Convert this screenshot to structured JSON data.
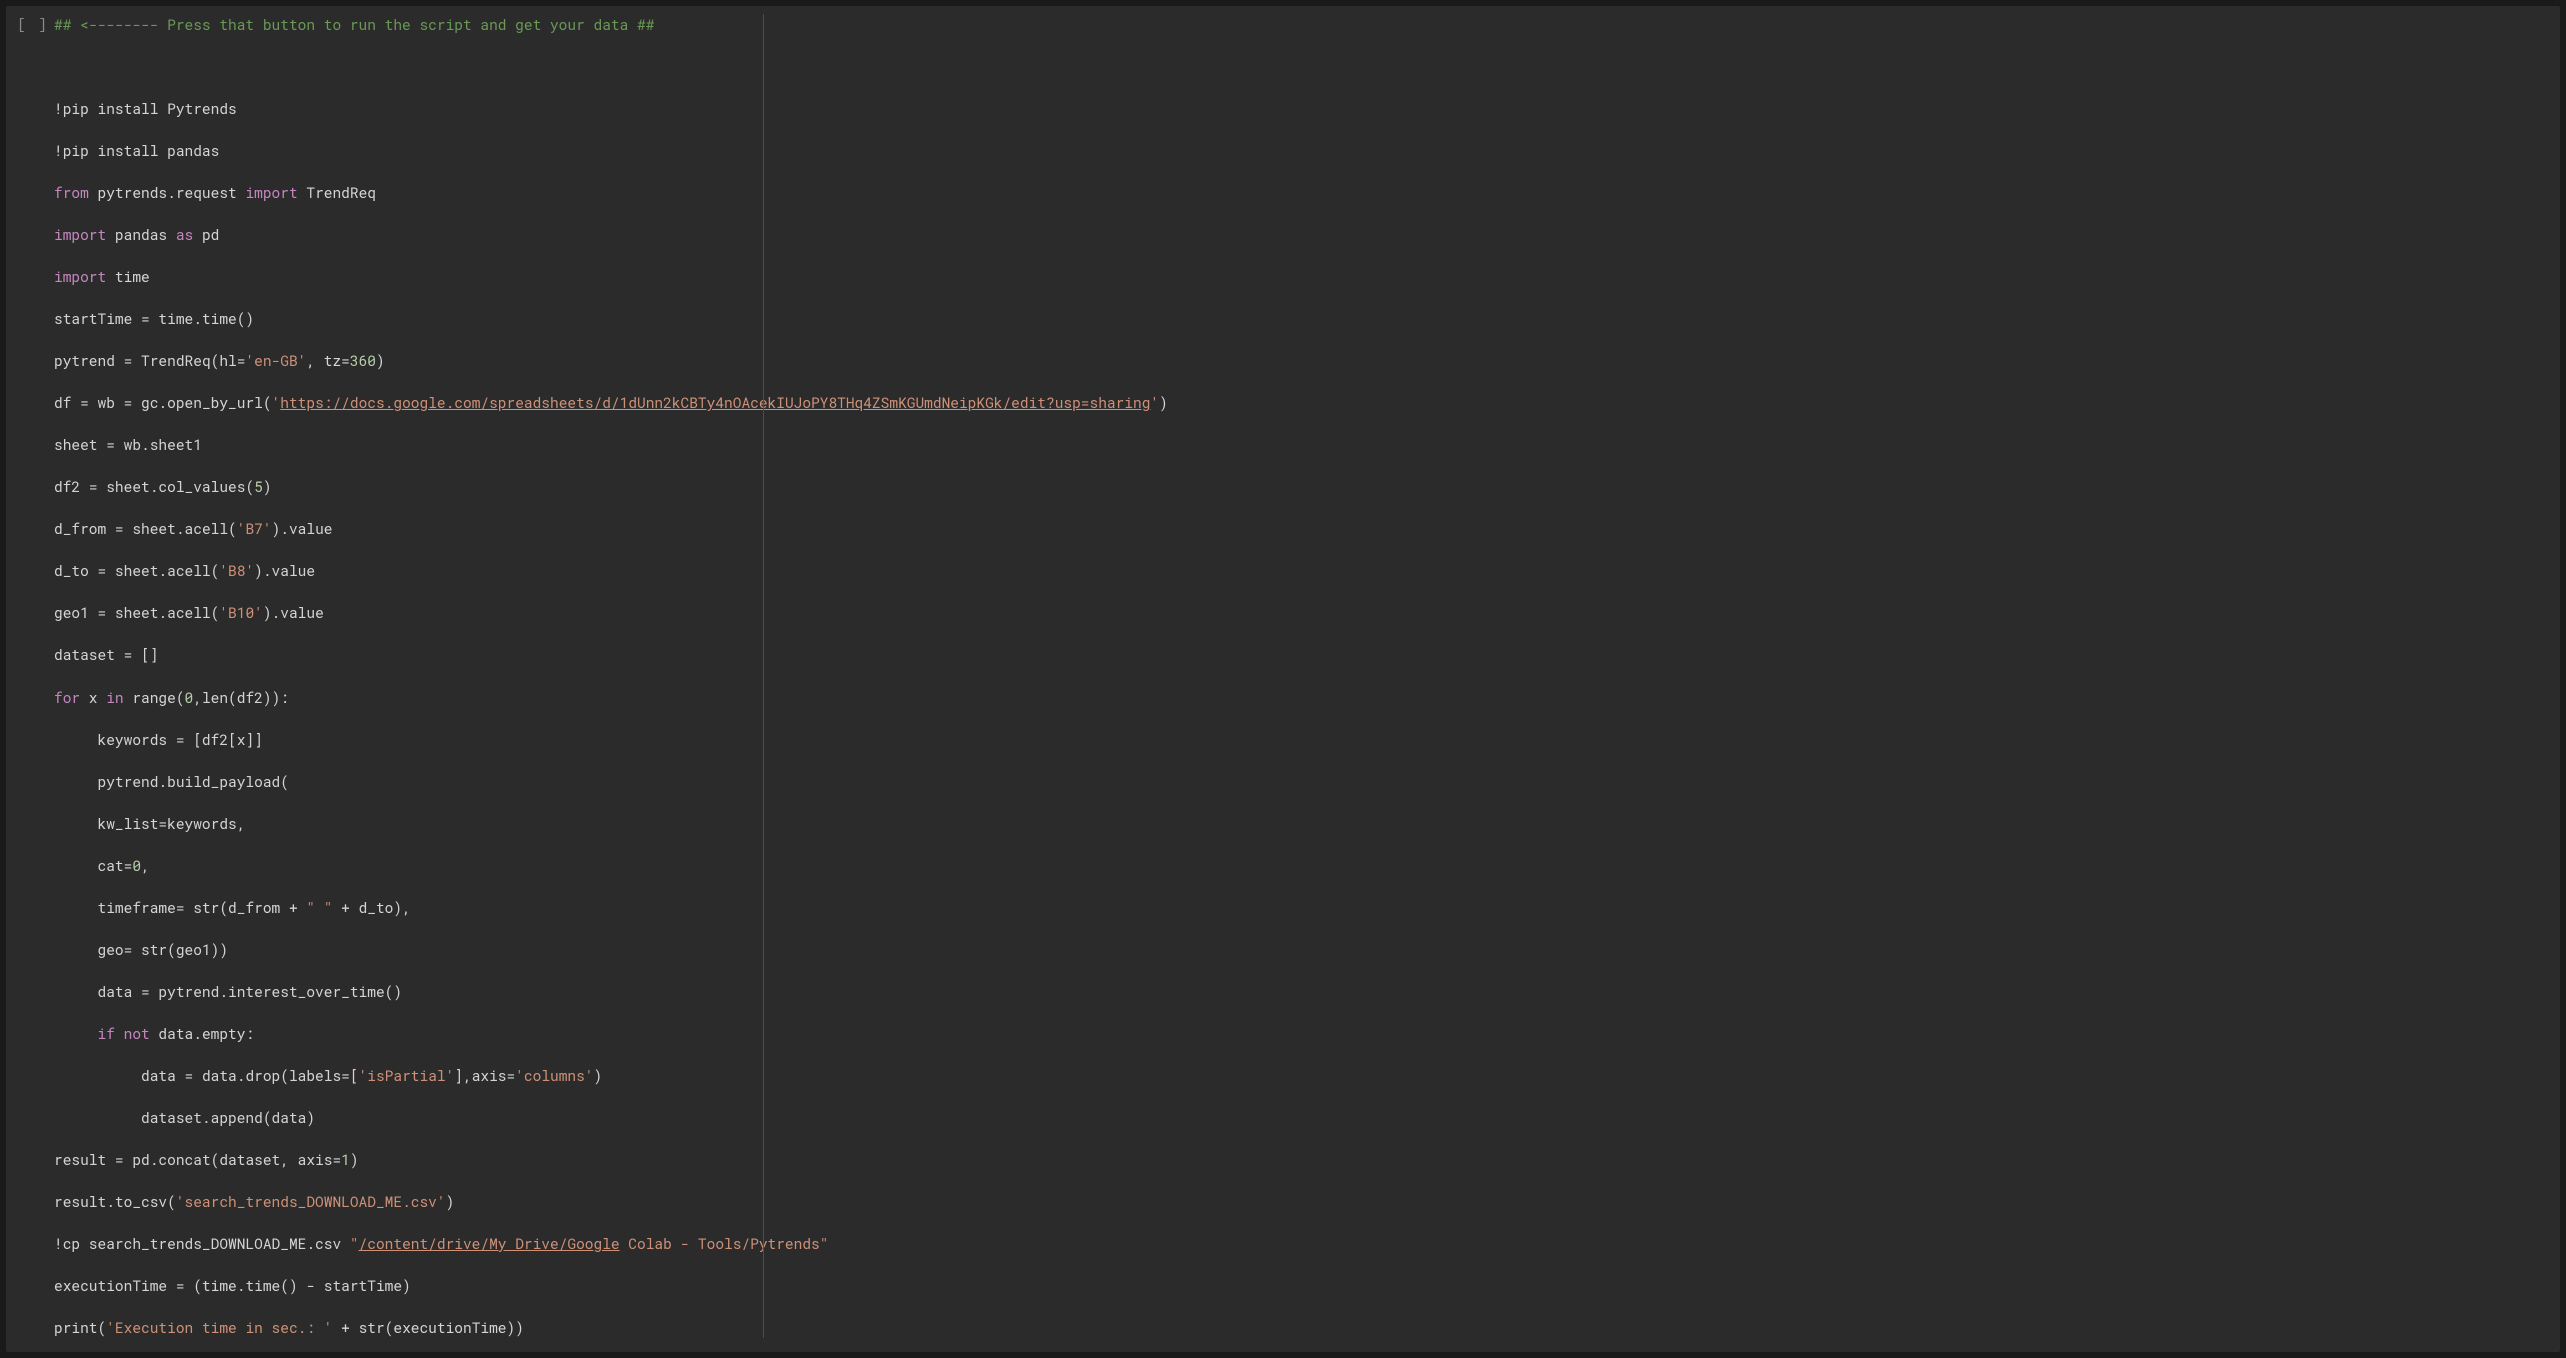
{
  "gutter": "[ ]",
  "code": {
    "comment_header": "## <-------- Press that button to run the script and get your data ##",
    "pip1_bang": "!",
    "pip1_rest": "pip install Pytrends",
    "pip2_bang": "!",
    "pip2_rest": "pip install pandas",
    "from": "from",
    "module1": " pytrends.request ",
    "import_kw1": "import",
    "import_name1": " TrendReq",
    "import_kw2": "import",
    "import_name2": " pandas ",
    "as_kw": "as",
    "as_name": " pd",
    "import_kw3": "import",
    "import_name3": " time",
    "l_starttime_a": "startTime ",
    "l_starttime_eq": "= ",
    "l_starttime_b": "time.time()",
    "l_pytrend_a": "pytrend ",
    "l_pytrend_eq": "= ",
    "l_pytrend_b": "TrendReq(hl=",
    "l_pytrend_str": "'en-GB'",
    "l_pytrend_c": ", tz=",
    "l_pytrend_num": "360",
    "l_pytrend_d": ")",
    "l_df_a": "df ",
    "l_df_eq1": "= ",
    "l_df_b": "wb ",
    "l_df_eq2": "= ",
    "l_df_c": "gc.open_by_url(",
    "l_df_q1": "'",
    "l_df_url": "https://docs.google.com/spreadsheets/d/1dUnn2kCBTy4nOAcekIUJoPY8THq4ZSmKGUmdNeipKGk/edit?usp=sharing",
    "l_df_q2": "'",
    "l_df_d": ")",
    "l_sheet_a": "sheet ",
    "l_sheet_eq": "= ",
    "l_sheet_b": "wb.sheet1",
    "l_df2_a": "df2 ",
    "l_df2_eq": "= ",
    "l_df2_b": "sheet.col_values(",
    "l_df2_num": "5",
    "l_df2_c": ")",
    "l_dfrom_a": "d_from ",
    "l_dfrom_eq": "= ",
    "l_dfrom_b": "sheet.acell(",
    "l_dfrom_str": "'B7'",
    "l_dfrom_c": ").value",
    "l_dto_a": "d_to ",
    "l_dto_eq": "= ",
    "l_dto_b": "sheet.acell(",
    "l_dto_str": "'B8'",
    "l_dto_c": ").value",
    "l_geo_a": "geo1 ",
    "l_geo_eq": "= ",
    "l_geo_b": "sheet.acell(",
    "l_geo_str": "'B10'",
    "l_geo_c": ").value",
    "l_dataset_a": "dataset ",
    "l_dataset_eq": "= ",
    "l_dataset_b": "[]",
    "for_kw": "for",
    "for_a": " x ",
    "in_kw": "in",
    "for_b": " range(",
    "for_num": "0",
    "for_c": ",len(df2)):",
    "l_kw_a": "     keywords ",
    "l_kw_eq": "= ",
    "l_kw_b": "[df2[x]]",
    "l_build": "     pytrend.build_payload(",
    "l_kwlist_a": "     kw_list",
    "l_kwlist_eq": "=",
    "l_kwlist_b": "keywords,",
    "l_cat_a": "     cat",
    "l_cat_eq": "=",
    "l_cat_num": "0",
    "l_cat_c": ",",
    "l_tf_a": "     timeframe",
    "l_tf_eq": "= ",
    "l_tf_b": "str(d_from + ",
    "l_tf_str": "\" \"",
    "l_tf_c": " + d_to),",
    "l_geoarg_a": "     geo",
    "l_geoarg_eq": "= ",
    "l_geoarg_b": "str(geo1))",
    "l_data_a": "     data ",
    "l_data_eq": "= ",
    "l_data_b": "pytrend.interest_over_time()",
    "if_kw": "if",
    "not_kw": "not",
    "if_pre": "     ",
    "if_mid": " ",
    "if_b": " data.empty:",
    "l_drop_a": "          data ",
    "l_drop_eq": "= ",
    "l_drop_b": "data.drop(labels=[",
    "l_drop_str1": "'isPartial'",
    "l_drop_c": "],axis=",
    "l_drop_str2": "'columns'",
    "l_drop_d": ")",
    "l_append": "          dataset.append(data)",
    "l_result_a": "result ",
    "l_result_eq": "= ",
    "l_result_b": "pd.concat(dataset, axis=",
    "l_result_num": "1",
    "l_result_c": ")",
    "l_tocsv_a": "result.to_csv(",
    "l_tocsv_str": "'search_trends_DOWNLOAD_ME.csv'",
    "l_tocsv_b": ")",
    "l_cp_bang": "!",
    "l_cp_a": "cp search_trends_DOWNLOAD_ME.csv ",
    "l_cp_q1": "\"",
    "l_cp_link": "/content/drive/My Drive/Google",
    "l_cp_rest": " Colab - Tools/Pytrends\"",
    "l_exec_a": "executionTime ",
    "l_exec_eq": "= ",
    "l_exec_b": "(time.time() - startTime)",
    "l_print_a": "print(",
    "l_print_str": "'Execution time in sec.: '",
    "l_print_b": " + str(executionTime))"
  }
}
